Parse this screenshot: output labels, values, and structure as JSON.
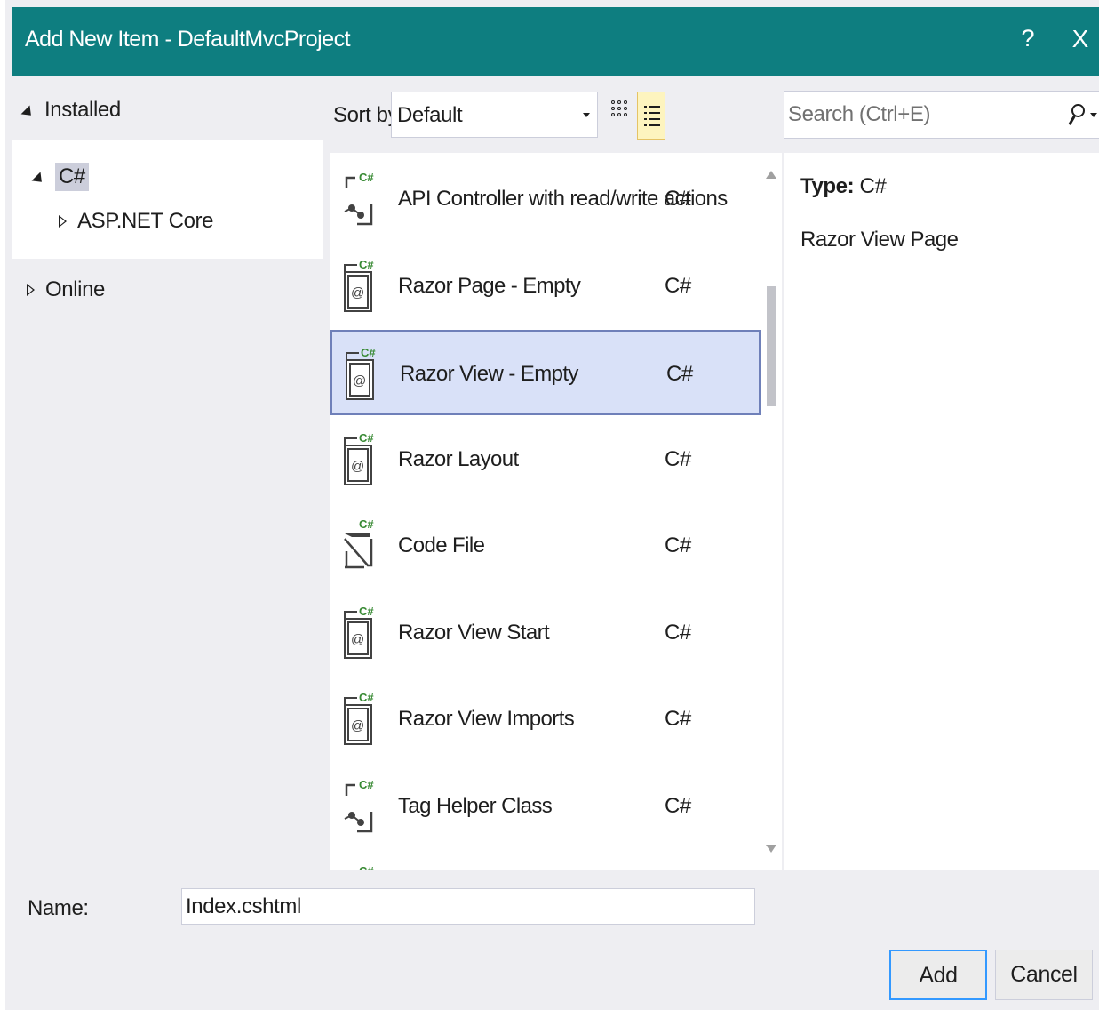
{
  "dialog": {
    "title": "Add New Item - DefaultMvcProject",
    "help_label": "?",
    "close_label": "X",
    "title_bar_color": "#0e7e80"
  },
  "tree": {
    "installed": "Installed",
    "csharp": "C#",
    "aspnet": "ASP.NET Core",
    "online": "Online"
  },
  "sort": {
    "label": "Sort by:",
    "value": "Default"
  },
  "search": {
    "placeholder": "Search (Ctrl+E)"
  },
  "templates": [
    {
      "name": "API Controller with read/write actions",
      "lang": "C#",
      "icon": "api-controller-icon",
      "selected": false
    },
    {
      "name": "Razor Page - Empty",
      "lang": "C#",
      "icon": "razor-file-icon",
      "selected": false
    },
    {
      "name": "Razor View - Empty",
      "lang": "C#",
      "icon": "razor-file-icon",
      "selected": true
    },
    {
      "name": "Razor Layout",
      "lang": "C#",
      "icon": "razor-file-icon",
      "selected": false
    },
    {
      "name": "Code File",
      "lang": "C#",
      "icon": "code-file-icon",
      "selected": false
    },
    {
      "name": "Razor View Start",
      "lang": "C#",
      "icon": "razor-file-icon",
      "selected": false
    },
    {
      "name": "Razor View Imports",
      "lang": "C#",
      "icon": "razor-file-icon",
      "selected": false
    },
    {
      "name": "Tag Helper Class",
      "lang": "C#",
      "icon": "api-controller-icon",
      "selected": false
    }
  ],
  "info": {
    "type_label": "Type:",
    "type_value": "C#",
    "description": "Razor View Page"
  },
  "footer": {
    "name_label": "Name:",
    "name_value": "Index.cshtml",
    "add_label": "Add",
    "cancel_label": "Cancel"
  }
}
